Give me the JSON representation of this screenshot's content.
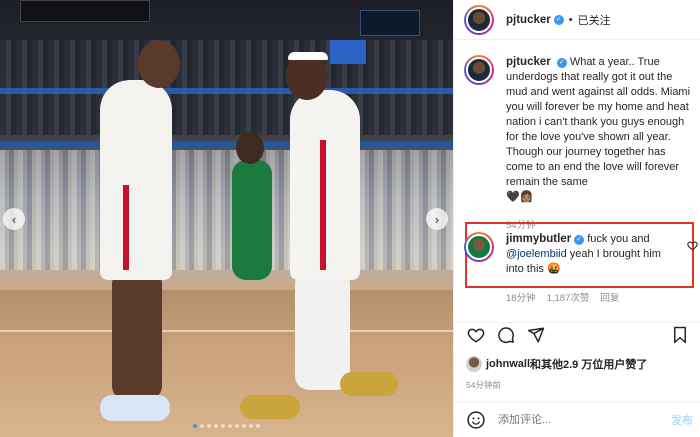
{
  "header": {
    "username": "pjtucker",
    "verified_icon": "verified-badge-icon",
    "separator": "•",
    "follow_status": "已关注"
  },
  "caption": {
    "username": "pjtucker",
    "text": "What a year.. True underdogs that really got it out the mud and went against all odds. Miami you will forever be my home and heat nation i can't thank you guys enough for the love you've shown all year. Though our journey together has come to an end the love will forever remain the same",
    "emoji": "🖤👩🏽",
    "time": "54分钟"
  },
  "comment": {
    "username": "jimmybutler",
    "text_before": "fuck you and",
    "mention": "@joelembiid",
    "text_after": "yeah I brought him into this 🤬",
    "time": "18分钟",
    "likes": "1,187次赞",
    "reply": "回复",
    "highlight_color": "#e0342c"
  },
  "likes": {
    "first_user": "johnwall",
    "rest": "和其他2.9 万位用户赞了"
  },
  "time": "54分钟前",
  "add_comment": {
    "placeholder": "添加评论...",
    "post_label": "发布"
  },
  "carousel": {
    "prev": "‹",
    "next": "›",
    "slide_count": 10,
    "active_index": 0
  },
  "colors": {
    "link": "#00376b",
    "verified": "#3897f0",
    "muted": "#8e8e8e"
  }
}
